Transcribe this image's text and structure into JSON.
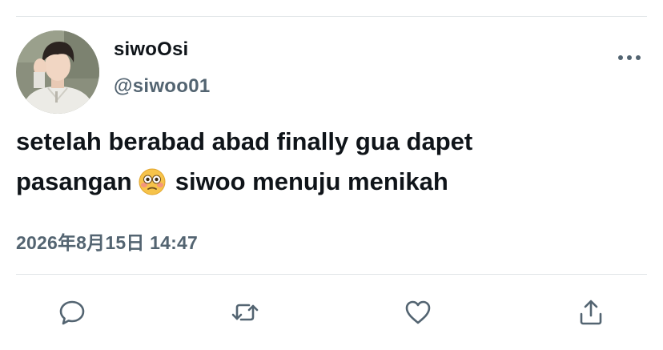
{
  "tweet": {
    "author": {
      "name": "siwoOsi",
      "handle": "@siwoo01"
    },
    "text_lines": [
      "setelah berabad abad finally gua dapet",
      "pasangan",
      "siwoo menuju menikah"
    ],
    "emoji": "flushed-face",
    "timestamp": "2026年8月15日 14:47"
  },
  "actions": [
    "reply",
    "retweet",
    "like",
    "share"
  ],
  "icons": {
    "more": "more-dots-icon",
    "reply": "reply-icon",
    "retweet": "retweet-icon",
    "like": "heart-icon",
    "share": "share-icon"
  },
  "colors": {
    "text": "#0f1419",
    "secondary": "#536471",
    "divider": "#e1e5e8",
    "icon": "#536471"
  }
}
